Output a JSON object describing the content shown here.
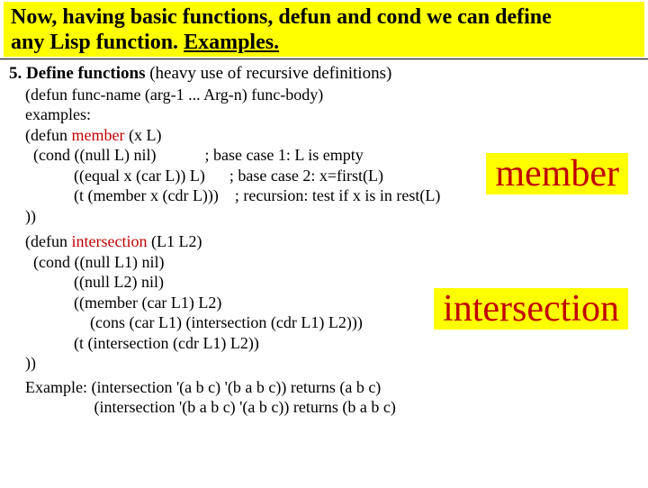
{
  "title": {
    "line1": "Now, having basic functions, defun and cond we can define",
    "line2_a": "any Lisp function. ",
    "line2_link": "Examples."
  },
  "section": {
    "head_bold": "5. Define functions",
    "head_rest": "  (heavy use of recursive definitions)",
    "proto": "(defun func-name (arg-1 ... Arg-n) func-body)",
    "examples_label": "examples:"
  },
  "member": {
    "l1a": "(defun ",
    "l1b": "member",
    "l1c": " (x L)",
    "l2": "  (cond ((null L) nil)            ; base case 1: L is empty",
    "l3": "            ((equal x (car L)) L)      ; base case 2: x=first(L)",
    "l4": "            (t (member x (cdr L)))    ; recursion: test if x is in rest(L)",
    "l5": "))"
  },
  "inter": {
    "l1a": "(defun ",
    "l1b": "intersection",
    "l1c": " (L1 L2)",
    "l2": "  (cond ((null L1) nil)",
    "l3": "            ((null L2) nil)",
    "l4": "            ((member (car L1) L2)",
    "l5": "                (cons (car L1) (intersection (cdr L1) L2)))",
    "l6": "            (t (intersection (cdr L1) L2))",
    "l7": "))"
  },
  "example": {
    "l1": "Example: (intersection '(a b c) '(b a b c)) returns (a b c)",
    "l2": "                 (intersection '(b a b c) '(a b c)) returns (b a b c)"
  },
  "badges": {
    "member": "member",
    "intersection": "intersection"
  }
}
